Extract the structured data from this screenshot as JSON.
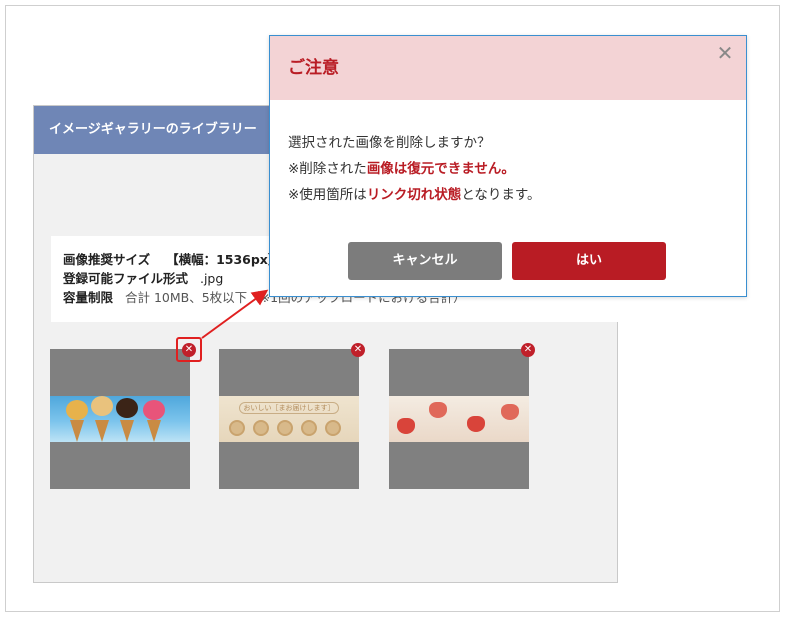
{
  "library": {
    "title": "イメージギャラリーのライブラリー",
    "info": {
      "size_label": "画像推奨サイズ",
      "size_value": "【横幅：1536px】",
      "format_label": "登録可能ファイル形式",
      "format_value": ".jpg",
      "capacity_label": "容量制限",
      "capacity_value": "合計 10MB、5枚以下（※1回のアップロードにおける合計）"
    },
    "thumbnails": [
      {
        "name": "ice-cream",
        "banner_text": ""
      },
      {
        "name": "sweets",
        "banner_text": "おいしい［まお届けします］"
      },
      {
        "name": "strawberry",
        "banner_text": ""
      }
    ]
  },
  "dialog": {
    "title": "ご注意",
    "close_glyph": "✕",
    "line1": "選択された画像を削除しますか？",
    "line2_prefix": "※削除された",
    "line2_emphasis": "画像は復元できません。",
    "line3_prefix": "※使用箇所は",
    "line3_emphasis": "リンク切れ状態",
    "line3_suffix": "となります。",
    "cancel_label": "キャンセル",
    "confirm_label": "はい"
  },
  "icons": {
    "delete_glyph": "✕",
    "delete_color": "#c0202a",
    "header_color": "#6f86b6",
    "accent_color": "#b91c24"
  }
}
